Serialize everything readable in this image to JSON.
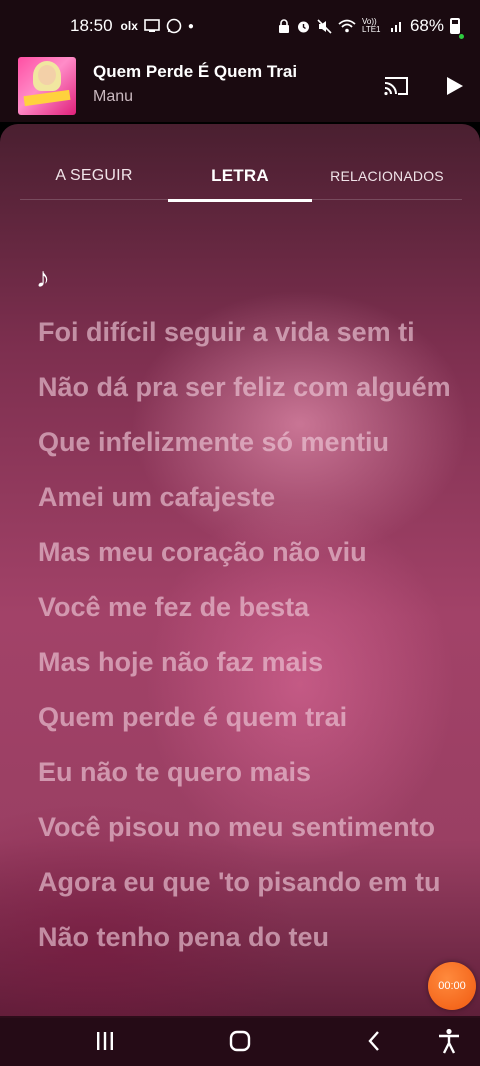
{
  "status_bar": {
    "time": "18:50",
    "olx_label": "olx",
    "battery": "68%",
    "network_label": "Vo)) LTE1"
  },
  "now_playing": {
    "title": "Quem Perde É Quem Trai",
    "artist": "Manu",
    "cover_icon": "album-cover",
    "cast_icon": "cast-icon",
    "play_icon": "play-icon"
  },
  "tabs": [
    {
      "label": "A SEGUIR",
      "active": false
    },
    {
      "label": "LETRA",
      "active": true
    },
    {
      "label": "RELACIONADOS",
      "active": false
    }
  ],
  "lyrics": {
    "note_glyph": "♪",
    "lines": [
      "Foi difícil seguir a vida sem ti",
      "Não dá pra ser feliz com alguém",
      "Que infelizmente só mentiu",
      "Amei um cafajeste",
      "Mas meu coração não viu",
      "Você me fez de besta",
      "Mas hoje não faz mais",
      "Quem perde é quem trai",
      "Eu não te quero mais",
      "Você pisou no meu sentimento",
      "Agora eu que 'to pisando em tu",
      "Não tenho pena do teu"
    ]
  },
  "timer_badge": "00:00",
  "nav_bar": [
    "recents-icon",
    "home-icon",
    "back-icon",
    "accessibility-icon"
  ],
  "colors": {
    "accent_orange": "#f05a10",
    "background_top": "#1a0a10",
    "panel_pink": "#a24268"
  }
}
